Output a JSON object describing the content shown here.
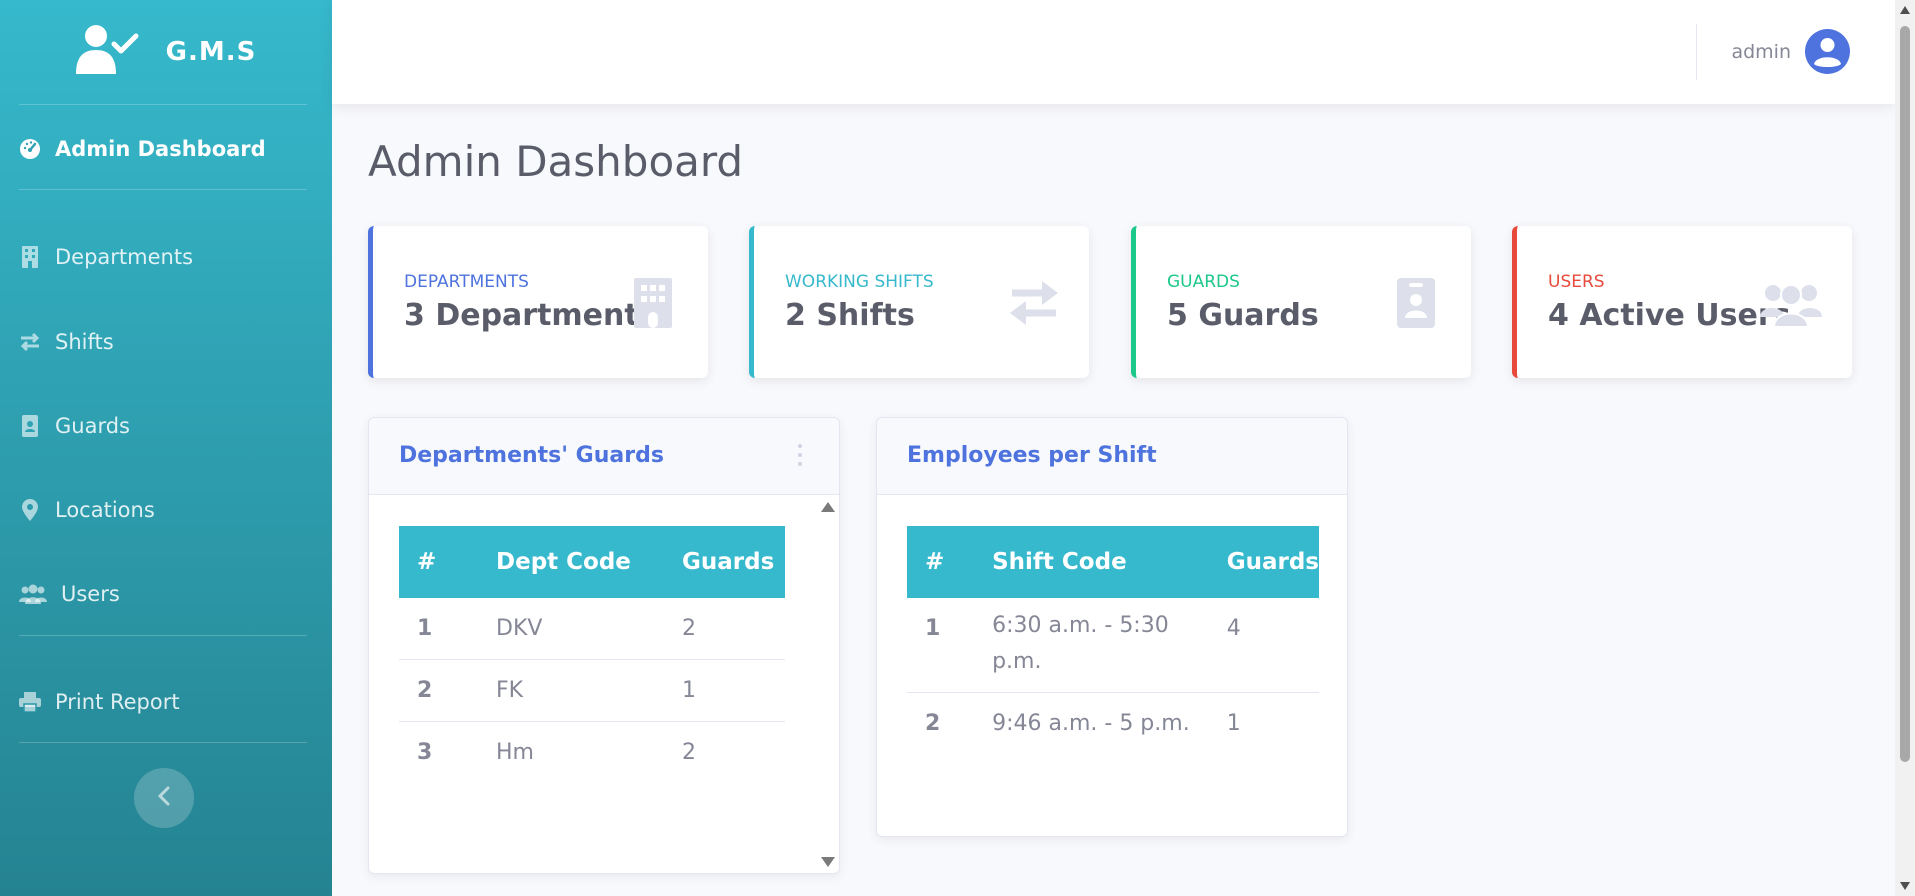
{
  "brand": {
    "name": "G.M.S"
  },
  "sidebar": {
    "active": {
      "label": "Admin Dashboard"
    },
    "items": [
      {
        "label": "Departments",
        "icon": "building-icon"
      },
      {
        "label": "Shifts",
        "icon": "exchange-icon"
      },
      {
        "label": "Guards",
        "icon": "id-card-icon"
      },
      {
        "label": "Locations",
        "icon": "map-marker-icon"
      },
      {
        "label": "Users",
        "icon": "users-icon"
      }
    ],
    "print": {
      "label": "Print Report",
      "icon": "print-icon"
    }
  },
  "topbar": {
    "user": "admin"
  },
  "page": {
    "title": "Admin Dashboard"
  },
  "colors": {
    "primary": "#4e73df",
    "info": "#36b9cc",
    "success": "#1cc88a",
    "danger": "#e74a3b",
    "icon_muted": "#dddfeb"
  },
  "stats": [
    {
      "label": "Departments",
      "value": "3 Departments",
      "color": "#4e73df",
      "icon": "building-icon"
    },
    {
      "label": "Working Shifts",
      "value": "2 Shifts",
      "color": "#36b9cc",
      "icon": "exchange-icon"
    },
    {
      "label": "Guards",
      "value": "5 Guards",
      "color": "#1cc88a",
      "icon": "id-card-icon"
    },
    {
      "label": "Users",
      "value": "4 Active Users",
      "color": "#e74a3b",
      "icon": "users-icon"
    }
  ],
  "dept_guards": {
    "title": "Departments' Guards",
    "headers": [
      "#",
      "Dept Code",
      "Guards"
    ],
    "rows": [
      [
        "1",
        "DKV",
        "2"
      ],
      [
        "2",
        "FK",
        "1"
      ],
      [
        "3",
        "Hm",
        "2"
      ]
    ]
  },
  "shift_employees": {
    "title": "Employees per Shift",
    "headers": [
      "#",
      "Shift Code",
      "Guards"
    ],
    "rows": [
      [
        "1",
        "6:30 a.m. - 5:30 p.m.",
        "4"
      ],
      [
        "2",
        "9:46 a.m. - 5 p.m.",
        "1"
      ]
    ]
  }
}
